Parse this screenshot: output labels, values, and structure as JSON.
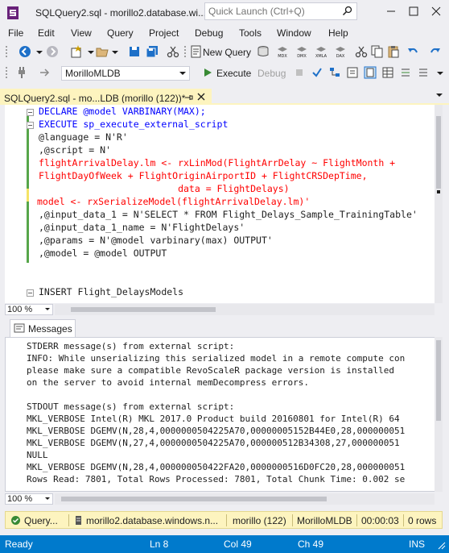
{
  "window": {
    "title": "SQLQuery2.sql - morillo2.database.wi...",
    "quick_launch_placeholder": "Quick Launch (Ctrl+Q)"
  },
  "menu": [
    "File",
    "Edit",
    "View",
    "Query",
    "Project",
    "Debug",
    "Tools",
    "Window",
    "Help"
  ],
  "toolbar": {
    "new_query_label": "New Query",
    "database": "MorilloMLDB",
    "execute_label": "Execute",
    "debug_label": "Debug",
    "icons": [
      "back-icon",
      "forward-icon",
      "new-project-icon",
      "open-file-icon",
      "save-icon",
      "save-all-icon",
      "new-query-icon",
      "mdx-icon",
      "dmx-icon",
      "xmla-icon",
      "dax-icon",
      "cut-icon",
      "copy-icon",
      "paste-icon",
      "undo-icon",
      "redo-icon",
      "execute-icon",
      "stop-icon",
      "parse-icon",
      "results-grid-icon",
      "results-text-icon"
    ]
  },
  "editor": {
    "tab_label": "SQLQuery2.sql - mo...LDB (morillo (122))*",
    "zoom": "100 %",
    "lines": [
      [
        "DECLARE @model VARBINARY(MAX);"
      ],
      [
        "EXECUTE sp_execute_external_script"
      ],
      [
        "@language = N'R'"
      ],
      [
        ",@script = N'"
      ],
      [
        "flightArrivalDelay.lm <- rxLinMod(FlightArrDelay ~ FlightMonth +"
      ],
      [
        "FlightDayOfWeek + FlightOriginAirportID + FlightCRSDepTime,"
      ],
      [
        "                         data = FlightDelays)"
      ],
      [
        "model <- rxSerializeModel(flightArrivalDelay.lm)'"
      ],
      [
        ",@input_data_1 = N'SELECT * FROM Flight_Delays_Sample_TrainingTable'"
      ],
      [
        ",@input_data_1_name = N'FlightDelays'"
      ],
      [
        ",@params = N'@model varbinary(max) OUTPUT'"
      ],
      [
        ",@model = @model OUTPUT"
      ],
      [
        ""
      ],
      [
        ""
      ],
      [
        "INSERT Flight_DelaysModels"
      ]
    ]
  },
  "results": {
    "tab_label": "Messages",
    "zoom": "100 %",
    "lines": [
      "STDERR message(s) from external script:",
      "INFO: While unserializing this serialized model in a remote compute con",
      "please make sure a compatible RevoScaleR package version is installed",
      "on the server to avoid internal memDecompress errors.",
      "",
      "STDOUT message(s) from external script:",
      "MKL_VERBOSE Intel(R) MKL 2017.0 Product build 20160801 for Intel(R) 64",
      "MKL_VERBOSE DGEMV(N,28,4,0000000504225A70,00000005152B44E0,28,000000051",
      "MKL_VERBOSE DGEMV(N,27,4,0000000504225A70,000000512B34308,27,000000051",
      "NULL",
      "MKL_VERBOSE DGEMV(N,28,4,000000050422FA20,0000000516D0FC20,28,000000051",
      "Rows Read: 7801, Total Rows Processed: 7801, Total Chunk Time: 0.002 se"
    ]
  },
  "query_status": {
    "state": "Query...",
    "server": "morillo2.database.windows.n...",
    "user": "morillo (122)",
    "database": "MorilloMLDB",
    "elapsed": "00:00:03",
    "rows": "0 rows"
  },
  "status_bar": {
    "state": "Ready",
    "line": "Ln 8",
    "col": "Col 49",
    "ch": "Ch 49",
    "mode": "INS"
  },
  "colors": {
    "status_bar": "#007acc",
    "tab_active": "#fdf4bf",
    "keyword": "#0000ff",
    "string": "#ff0000",
    "function": "#800000"
  }
}
